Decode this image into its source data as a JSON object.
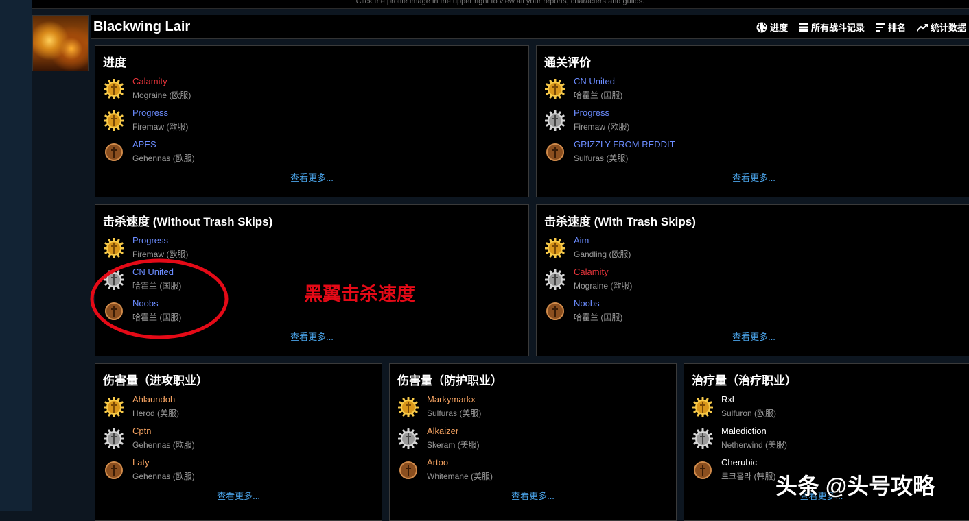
{
  "top_notice": "Click the profile image in the upper right to view all your reports, characters and guilds.",
  "zone": {
    "title": "Blackwing Lair"
  },
  "tabs": [
    {
      "label": "进度",
      "icon": "globe-icon"
    },
    {
      "label": "所有战斗记录",
      "icon": "list-icon"
    },
    {
      "label": "排名",
      "icon": "ranking-icon"
    },
    {
      "label": "统计数据",
      "icon": "trend-icon"
    }
  ],
  "panels": {
    "progress": {
      "title": "进度",
      "entries": [
        {
          "name": "Calamity",
          "server": "Mograine (欧服)",
          "medal": "gold",
          "color": "#e8353b"
        },
        {
          "name": "Progress",
          "server": "Firemaw (欧服)",
          "medal": "gold",
          "color": "#6b8cff"
        },
        {
          "name": "APES",
          "server": "Gehennas (欧服)",
          "medal": "bronze",
          "color": "#6b8cff"
        }
      ],
      "more": "查看更多..."
    },
    "clear_rating": {
      "title": "通关评价",
      "entries": [
        {
          "name": "CN United",
          "server": "哈霍兰 (国服)",
          "medal": "gold",
          "color": "#6b8cff"
        },
        {
          "name": "Progress",
          "server": "Firemaw (欧服)",
          "medal": "silver",
          "color": "#6b8cff"
        },
        {
          "name": "GRIZZLY FROM REDDIT",
          "server": "Sulfuras (美服)",
          "medal": "bronze",
          "color": "#6b8cff"
        }
      ],
      "more": "查看更多..."
    },
    "speed_no_skip": {
      "title": "击杀速度 (Without Trash Skips)",
      "entries": [
        {
          "name": "Progress",
          "server": "Firemaw (欧服)",
          "medal": "gold",
          "color": "#6b8cff"
        },
        {
          "name": "CN United",
          "server": "哈霍兰 (国服)",
          "medal": "silver",
          "color": "#6b8cff"
        },
        {
          "name": "Noobs",
          "server": "哈霍兰 (国服)",
          "medal": "bronze",
          "color": "#6b8cff"
        }
      ],
      "more": "查看更多..."
    },
    "speed_skip": {
      "title": "击杀速度 (With Trash Skips)",
      "entries": [
        {
          "name": "Aim",
          "server": "Gandling (欧服)",
          "medal": "gold",
          "color": "#6b8cff"
        },
        {
          "name": "Calamity",
          "server": "Mograine (欧服)",
          "medal": "silver",
          "color": "#e8353b"
        },
        {
          "name": "Noobs",
          "server": "哈霍兰 (国服)",
          "medal": "bronze",
          "color": "#6b8cff"
        }
      ],
      "more": "查看更多..."
    },
    "dps": {
      "title": "伤害量（进攻职业）",
      "entries": [
        {
          "name": "Ahlaundoh",
          "server": "Herod (美服)",
          "medal": "gold",
          "color": "#f4a261"
        },
        {
          "name": "Cptn",
          "server": "Gehennas (欧服)",
          "medal": "silver",
          "color": "#f4a261"
        },
        {
          "name": "Laty",
          "server": "Gehennas (欧服)",
          "medal": "bronze",
          "color": "#f4a261"
        }
      ],
      "more": "查看更多..."
    },
    "tank": {
      "title": "伤害量（防护职业）",
      "entries": [
        {
          "name": "Markymarkx",
          "server": "Sulfuras (美服)",
          "medal": "gold",
          "color": "#f4a261"
        },
        {
          "name": "Alkaizer",
          "server": "Skeram (美服)",
          "medal": "silver",
          "color": "#f4a261"
        },
        {
          "name": "Artoo",
          "server": "Whitemane (美服)",
          "medal": "bronze",
          "color": "#f4a261"
        }
      ],
      "more": "查看更多..."
    },
    "healer": {
      "title": "治疗量（治疗职业）",
      "entries": [
        {
          "name": "Rxl",
          "server": "Sulfuron (欧服)",
          "medal": "gold",
          "color": "#ffffff"
        },
        {
          "name": "Malediction",
          "server": "Netherwind (美服)",
          "medal": "silver",
          "color": "#ffffff"
        },
        {
          "name": "Cherubic",
          "server": "로크홀라 (韩服)",
          "medal": "bronze",
          "color": "#ffffff"
        }
      ],
      "more": "查看更多..."
    }
  },
  "annotation": {
    "text": "黑翼击杀速度",
    "color": "#e40a17"
  },
  "watermark": "头条 @头号攻略"
}
